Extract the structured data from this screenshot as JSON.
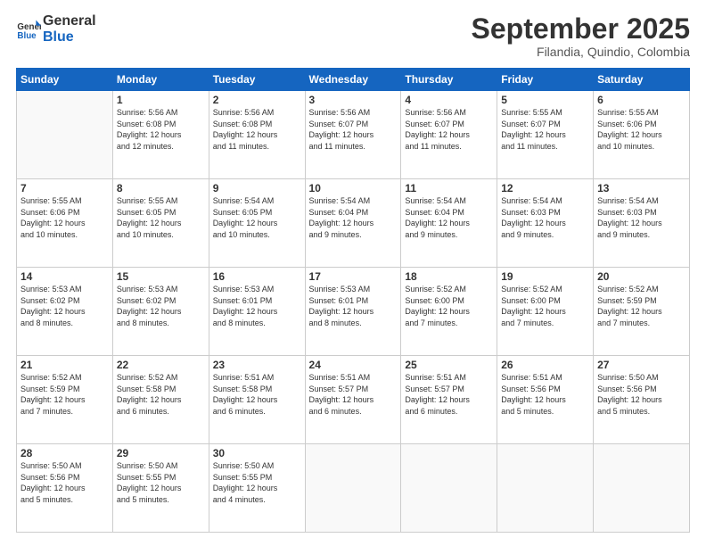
{
  "header": {
    "logo_line1": "General",
    "logo_line2": "Blue",
    "month": "September 2025",
    "location": "Filandia, Quindio, Colombia"
  },
  "days_of_week": [
    "Sunday",
    "Monday",
    "Tuesday",
    "Wednesday",
    "Thursday",
    "Friday",
    "Saturday"
  ],
  "weeks": [
    [
      {
        "day": "",
        "info": ""
      },
      {
        "day": "1",
        "info": "Sunrise: 5:56 AM\nSunset: 6:08 PM\nDaylight: 12 hours\nand 12 minutes."
      },
      {
        "day": "2",
        "info": "Sunrise: 5:56 AM\nSunset: 6:08 PM\nDaylight: 12 hours\nand 11 minutes."
      },
      {
        "day": "3",
        "info": "Sunrise: 5:56 AM\nSunset: 6:07 PM\nDaylight: 12 hours\nand 11 minutes."
      },
      {
        "day": "4",
        "info": "Sunrise: 5:56 AM\nSunset: 6:07 PM\nDaylight: 12 hours\nand 11 minutes."
      },
      {
        "day": "5",
        "info": "Sunrise: 5:55 AM\nSunset: 6:07 PM\nDaylight: 12 hours\nand 11 minutes."
      },
      {
        "day": "6",
        "info": "Sunrise: 5:55 AM\nSunset: 6:06 PM\nDaylight: 12 hours\nand 10 minutes."
      }
    ],
    [
      {
        "day": "7",
        "info": "Sunrise: 5:55 AM\nSunset: 6:06 PM\nDaylight: 12 hours\nand 10 minutes."
      },
      {
        "day": "8",
        "info": "Sunrise: 5:55 AM\nSunset: 6:05 PM\nDaylight: 12 hours\nand 10 minutes."
      },
      {
        "day": "9",
        "info": "Sunrise: 5:54 AM\nSunset: 6:05 PM\nDaylight: 12 hours\nand 10 minutes."
      },
      {
        "day": "10",
        "info": "Sunrise: 5:54 AM\nSunset: 6:04 PM\nDaylight: 12 hours\nand 9 minutes."
      },
      {
        "day": "11",
        "info": "Sunrise: 5:54 AM\nSunset: 6:04 PM\nDaylight: 12 hours\nand 9 minutes."
      },
      {
        "day": "12",
        "info": "Sunrise: 5:54 AM\nSunset: 6:03 PM\nDaylight: 12 hours\nand 9 minutes."
      },
      {
        "day": "13",
        "info": "Sunrise: 5:54 AM\nSunset: 6:03 PM\nDaylight: 12 hours\nand 9 minutes."
      }
    ],
    [
      {
        "day": "14",
        "info": "Sunrise: 5:53 AM\nSunset: 6:02 PM\nDaylight: 12 hours\nand 8 minutes."
      },
      {
        "day": "15",
        "info": "Sunrise: 5:53 AM\nSunset: 6:02 PM\nDaylight: 12 hours\nand 8 minutes."
      },
      {
        "day": "16",
        "info": "Sunrise: 5:53 AM\nSunset: 6:01 PM\nDaylight: 12 hours\nand 8 minutes."
      },
      {
        "day": "17",
        "info": "Sunrise: 5:53 AM\nSunset: 6:01 PM\nDaylight: 12 hours\nand 8 minutes."
      },
      {
        "day": "18",
        "info": "Sunrise: 5:52 AM\nSunset: 6:00 PM\nDaylight: 12 hours\nand 7 minutes."
      },
      {
        "day": "19",
        "info": "Sunrise: 5:52 AM\nSunset: 6:00 PM\nDaylight: 12 hours\nand 7 minutes."
      },
      {
        "day": "20",
        "info": "Sunrise: 5:52 AM\nSunset: 5:59 PM\nDaylight: 12 hours\nand 7 minutes."
      }
    ],
    [
      {
        "day": "21",
        "info": "Sunrise: 5:52 AM\nSunset: 5:59 PM\nDaylight: 12 hours\nand 7 minutes."
      },
      {
        "day": "22",
        "info": "Sunrise: 5:52 AM\nSunset: 5:58 PM\nDaylight: 12 hours\nand 6 minutes."
      },
      {
        "day": "23",
        "info": "Sunrise: 5:51 AM\nSunset: 5:58 PM\nDaylight: 12 hours\nand 6 minutes."
      },
      {
        "day": "24",
        "info": "Sunrise: 5:51 AM\nSunset: 5:57 PM\nDaylight: 12 hours\nand 6 minutes."
      },
      {
        "day": "25",
        "info": "Sunrise: 5:51 AM\nSunset: 5:57 PM\nDaylight: 12 hours\nand 6 minutes."
      },
      {
        "day": "26",
        "info": "Sunrise: 5:51 AM\nSunset: 5:56 PM\nDaylight: 12 hours\nand 5 minutes."
      },
      {
        "day": "27",
        "info": "Sunrise: 5:50 AM\nSunset: 5:56 PM\nDaylight: 12 hours\nand 5 minutes."
      }
    ],
    [
      {
        "day": "28",
        "info": "Sunrise: 5:50 AM\nSunset: 5:56 PM\nDaylight: 12 hours\nand 5 minutes."
      },
      {
        "day": "29",
        "info": "Sunrise: 5:50 AM\nSunset: 5:55 PM\nDaylight: 12 hours\nand 5 minutes."
      },
      {
        "day": "30",
        "info": "Sunrise: 5:50 AM\nSunset: 5:55 PM\nDaylight: 12 hours\nand 4 minutes."
      },
      {
        "day": "",
        "info": ""
      },
      {
        "day": "",
        "info": ""
      },
      {
        "day": "",
        "info": ""
      },
      {
        "day": "",
        "info": ""
      }
    ]
  ]
}
